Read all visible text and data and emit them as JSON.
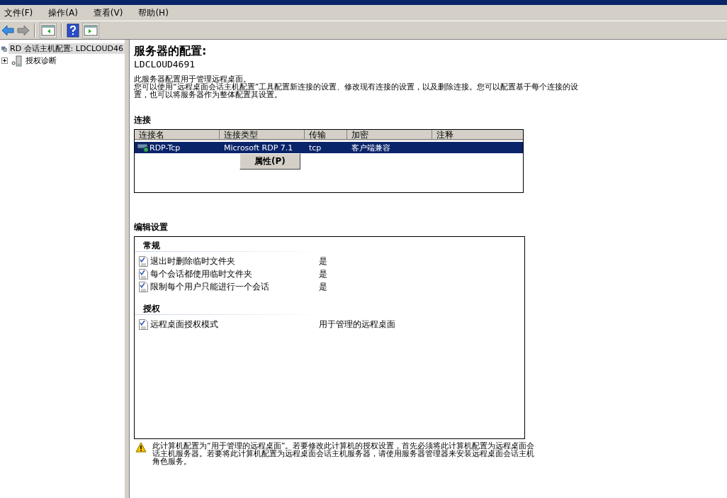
{
  "menu_bar": [
    "文件(F)",
    "操作(A)",
    "查看(V)",
    "帮助(H)"
  ],
  "toolbar": [
    {
      "kind": "back",
      "disabled": false
    },
    {
      "kind": "forward",
      "disabled": true
    },
    {
      "kind": "separator"
    },
    {
      "kind": "tree",
      "disabled": false
    },
    {
      "kind": "separator"
    },
    {
      "kind": "help",
      "disabled": false
    },
    {
      "kind": "pane",
      "disabled": false
    }
  ],
  "tree": [
    {
      "label": "RD 会话主机配置: LDCLOUD46",
      "selected": true,
      "kind": "server"
    },
    {
      "label": "授权诊断",
      "selected": false,
      "expanded": false,
      "kind": "diag"
    }
  ],
  "header": {
    "title": "服务器的配置:",
    "server": "LDCLOUD4691",
    "description": [
      "此服务器配置用于管理远程桌面。",
      "您可以使用“远程桌面会话主机配置”工具配置新连接的设置、修改现有连接的设置，以及删除连接。您可以配置基于每个连接的设置，也可以将服务器作为整体配置其设置。"
    ]
  },
  "connections": {
    "title": "连接",
    "columns": [
      "连接名",
      "连接类型",
      "传输",
      "加密",
      "注释"
    ],
    "rows": [
      {
        "cells": [
          "RDP-Tcp",
          "Microsoft RDP 7.1",
          "tcp",
          "客户端兼容",
          ""
        ],
        "selected": true
      }
    ],
    "context_menu": [
      "属性(P)"
    ]
  },
  "edit_settings": {
    "title": "编辑设置",
    "groups": [
      {
        "title": "常规",
        "items": [
          {
            "name": "退出时删除临时文件夹",
            "value": "是"
          },
          {
            "name": "每个会话都使用临时文件夹",
            "value": "是"
          },
          {
            "name": "限制每个用户只能进行一个会话",
            "value": "是"
          }
        ]
      },
      {
        "title": "授权",
        "items": [
          {
            "name": "远程桌面授权模式",
            "value": "用于管理的远程桌面"
          }
        ]
      }
    ]
  },
  "warning": "此计算机配置为“用于管理的远程桌面”。若要修改此计算机的授权设置，首先必须将此计算机配置为远程桌面会话主机服务器。若要将此计算机配置为远程桌面会话主机服务器，请使用服务器管理器来安装远程桌面会话主机角色服务。"
}
